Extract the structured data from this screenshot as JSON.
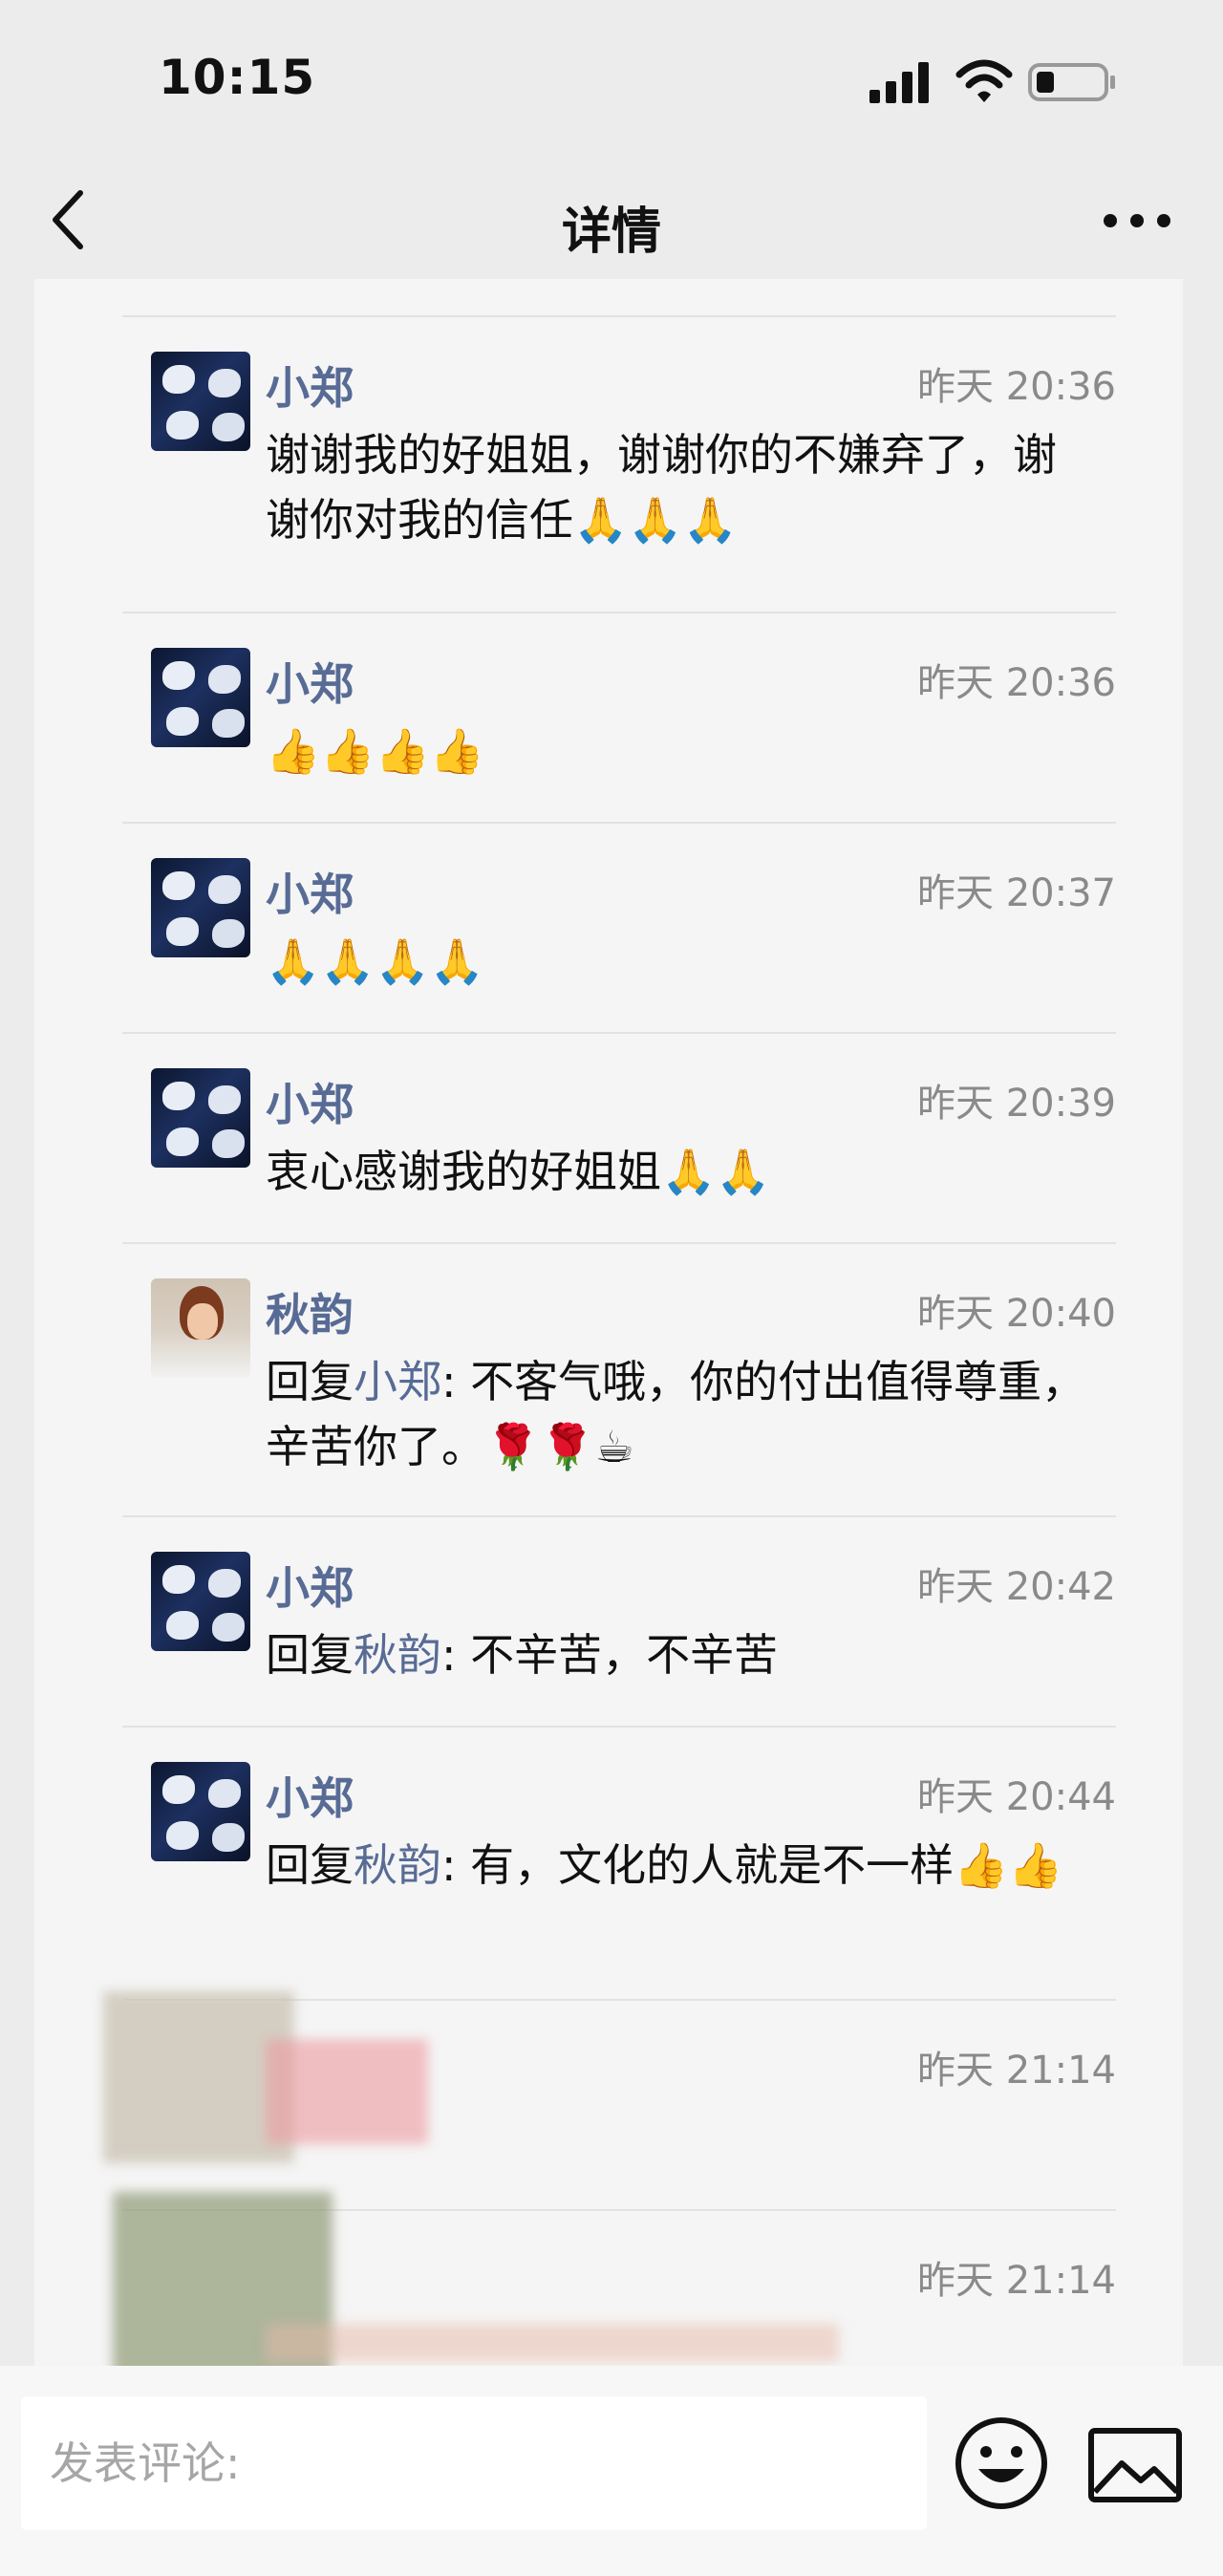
{
  "status_bar": {
    "time": "10:15"
  },
  "nav": {
    "title": "详情",
    "back_icon": "chevron-left-icon",
    "more_icon": "more-dots-icon"
  },
  "comments": [
    {
      "user": "小郑",
      "time": "昨天 20:36",
      "text": "谢谢我的好姐姐，谢谢你的不嫌弃了，谢谢你对我的信任🙏🙏🙏",
      "avatar": "zheng"
    },
    {
      "user": "小郑",
      "time": "昨天 20:36",
      "text": "👍👍👍👍",
      "avatar": "zheng"
    },
    {
      "user": "小郑",
      "time": "昨天 20:37",
      "text": "🙏🙏🙏🙏",
      "avatar": "zheng"
    },
    {
      "user": "小郑",
      "time": "昨天 20:39",
      "text": "衷心感谢我的好姐姐🙏🙏",
      "avatar": "zheng"
    },
    {
      "user": "秋韵",
      "time": "昨天 20:40",
      "reply_label": "回复",
      "reply_to": "小郑",
      "text": ": 不客气哦，你的付出值得尊重，辛苦你了。🌹🌹☕",
      "avatar": "qiu"
    },
    {
      "user": "小郑",
      "time": "昨天 20:42",
      "reply_label": "回复",
      "reply_to": "秋韵",
      "text": ": 不辛苦，不辛苦",
      "avatar": "zheng"
    },
    {
      "user": "小郑",
      "time": "昨天 20:44",
      "reply_label": "回复",
      "reply_to": "秋韵",
      "text": ": 有，文化的人就是不一样👍👍",
      "avatar": "zheng"
    },
    {
      "user": "",
      "time": "昨天 21:14",
      "text": "",
      "avatar": "blurred"
    },
    {
      "user": "",
      "time": "昨天 21:14",
      "text": "",
      "avatar": "blurred"
    }
  ],
  "bottom_bar": {
    "placeholder": "发表评论:",
    "emoji_icon": "smiley-face-icon",
    "image_icon": "image-picture-icon"
  },
  "colors": {
    "name_blue": "#576b95",
    "time_gray": "#8a8a8a",
    "background": "#ececec"
  }
}
